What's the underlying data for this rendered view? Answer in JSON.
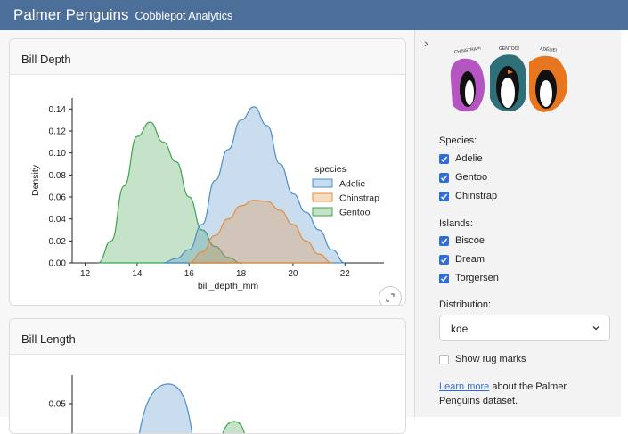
{
  "navbar": {
    "title": "Palmer Penguins",
    "subtitle": "Cobblepot Analytics"
  },
  "cards": {
    "bill_depth": {
      "title": "Bill Depth"
    },
    "bill_length": {
      "title": "Bill Length"
    }
  },
  "chart_data": [
    {
      "type": "area",
      "title": "",
      "xlabel": "bill_depth_mm",
      "ylabel": "Density",
      "xlim": [
        11.5,
        23.5
      ],
      "ylim": [
        0,
        0.15
      ],
      "xticks": [
        "12",
        "14",
        "16",
        "18",
        "20",
        "22"
      ],
      "yticks": [
        "0.00",
        "0.02",
        "0.04",
        "0.06",
        "0.08",
        "0.10",
        "0.12",
        "0.14"
      ],
      "legend": {
        "title": "species",
        "position": "center-right"
      },
      "series": [
        {
          "name": "Adelie",
          "color": "#4c8fc8",
          "x": [
            15.0,
            15.5,
            16.0,
            16.5,
            17.0,
            17.5,
            18.0,
            18.5,
            19.0,
            19.5,
            20.0,
            20.5,
            21.0,
            21.5,
            22.0
          ],
          "y": [
            0.0,
            0.004,
            0.012,
            0.035,
            0.075,
            0.103,
            0.13,
            0.142,
            0.125,
            0.09,
            0.063,
            0.046,
            0.03,
            0.012,
            0.0
          ]
        },
        {
          "name": "Chinstrap",
          "color": "#e68c3c",
          "x": [
            16.0,
            16.5,
            17.0,
            17.5,
            18.0,
            18.5,
            19.0,
            19.5,
            20.0,
            20.5,
            21.0,
            21.5
          ],
          "y": [
            0.0,
            0.01,
            0.025,
            0.04,
            0.052,
            0.057,
            0.056,
            0.048,
            0.035,
            0.02,
            0.008,
            0.0
          ]
        },
        {
          "name": "Gentoo",
          "color": "#3fa34d",
          "x": [
            12.5,
            13.0,
            13.5,
            14.0,
            14.5,
            15.0,
            15.5,
            16.0,
            16.5,
            17.0,
            17.5,
            18.0
          ],
          "y": [
            0.0,
            0.02,
            0.07,
            0.115,
            0.128,
            0.11,
            0.092,
            0.06,
            0.03,
            0.015,
            0.005,
            0.0
          ]
        }
      ]
    },
    {
      "type": "area",
      "title": "",
      "yticks": [
        "0.05"
      ],
      "series": []
    }
  ],
  "sidebar": {
    "species_label": "Species:",
    "species": [
      {
        "label": "Adelie",
        "checked": true
      },
      {
        "label": "Gentoo",
        "checked": true
      },
      {
        "label": "Chinstrap",
        "checked": true
      }
    ],
    "islands_label": "Islands:",
    "islands": [
      {
        "label": "Biscoe",
        "checked": true
      },
      {
        "label": "Dream",
        "checked": true
      },
      {
        "label": "Torgersen",
        "checked": true
      }
    ],
    "distribution_label": "Distribution:",
    "distribution_value": "kde",
    "rug_label": "Show rug marks",
    "learn_link": "Learn more",
    "learn_text": " about the Palmer Penguins dataset.",
    "penguin_names": [
      "CHINSTRAP!",
      "GENTOO!",
      "ADÉLIE!"
    ]
  }
}
